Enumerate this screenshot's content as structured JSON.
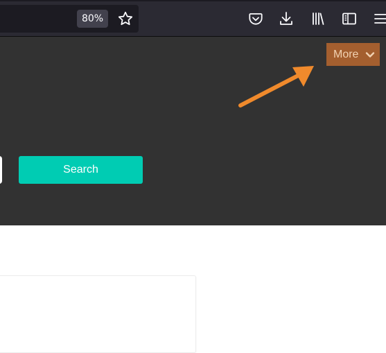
{
  "toolbar": {
    "zoom_level": "80%",
    "icons": [
      "star-icon",
      "pocket-icon",
      "download-icon",
      "library-icon",
      "sidebar-icon",
      "menu-icon"
    ]
  },
  "hero": {
    "more_label": "More",
    "search_label": "Search"
  },
  "colors": {
    "toolbar_bg": "#2b2a33",
    "hero_bg": "#323232",
    "more_button_bg": "#a45f2f",
    "more_button_text": "#f2d2b2",
    "annotation_arrow": "#f08a2c",
    "search_button_bg": "#00ccb3"
  }
}
